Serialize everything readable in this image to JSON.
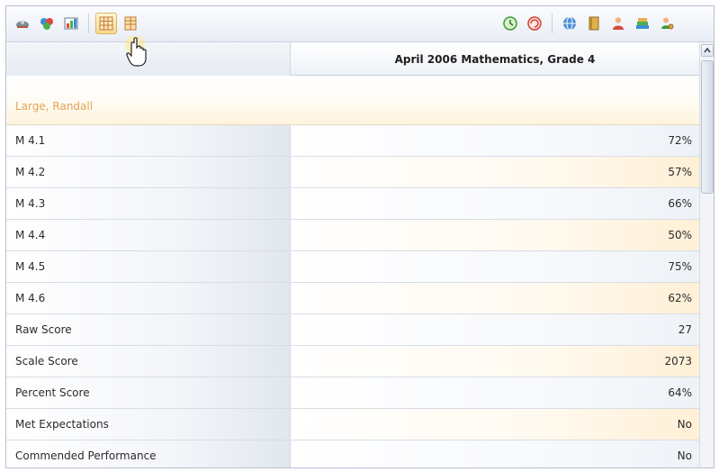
{
  "colors": {
    "student_name": "#e1a35a",
    "active_tool": "#f6d98f",
    "border": "#b9c2cf"
  },
  "toolbar": {
    "left_tools": [
      {
        "icon": "helmet-icon",
        "active": false
      },
      {
        "icon": "multicolor-shape-icon",
        "active": false
      },
      {
        "icon": "colored-grid-chart-icon",
        "active": true
      },
      {
        "icon": "table-view-icon",
        "active": false
      },
      {
        "icon": "column-view-icon",
        "active": false
      }
    ],
    "right_tools": [
      {
        "icon": "green-clock-icon"
      },
      {
        "icon": "red-refresh-icon"
      },
      {
        "icon": "blue-globe-icon"
      },
      {
        "icon": "book-icon"
      },
      {
        "icon": "person-icon"
      },
      {
        "icon": "stacked-books-icon"
      },
      {
        "icon": "user-gear-icon"
      }
    ]
  },
  "table": {
    "column_header": "April 2006 Mathematics, Grade 4",
    "student_name": "Large, Randall",
    "rows": [
      {
        "label": "M 4.1",
        "value": "72%"
      },
      {
        "label": "M 4.2",
        "value": "57%"
      },
      {
        "label": "M 4.3",
        "value": "66%"
      },
      {
        "label": "M 4.4",
        "value": "50%"
      },
      {
        "label": "M 4.5",
        "value": "75%"
      },
      {
        "label": "M 4.6",
        "value": "62%"
      },
      {
        "label": "Raw Score",
        "value": "27"
      },
      {
        "label": "Scale Score",
        "value": "2073"
      },
      {
        "label": "Percent Score",
        "value": "64%"
      },
      {
        "label": "Met Expectations",
        "value": "No"
      },
      {
        "label": "Commended Performance",
        "value": "No"
      }
    ]
  }
}
